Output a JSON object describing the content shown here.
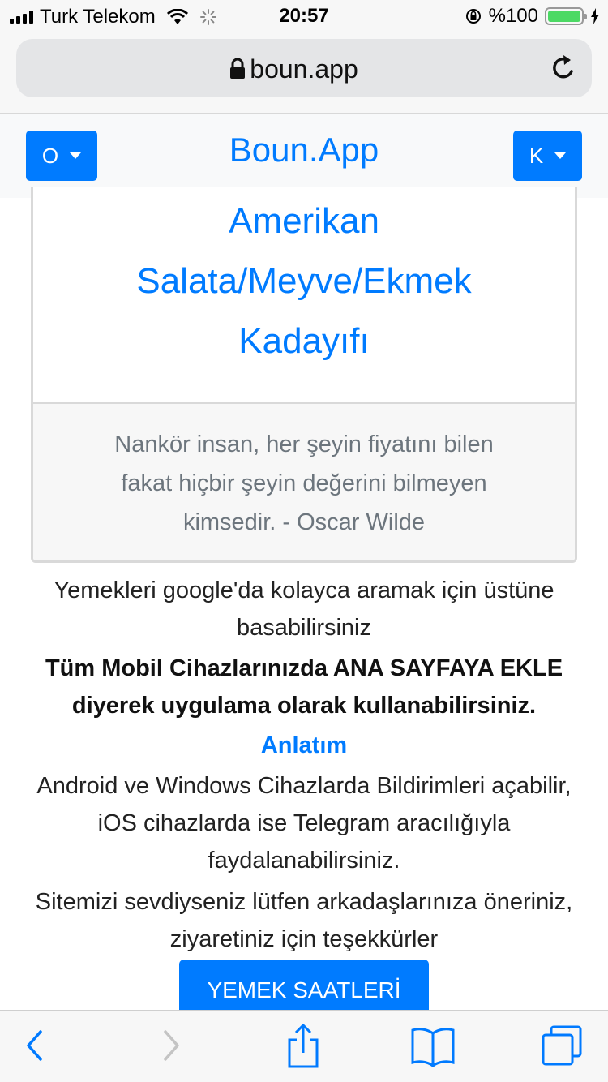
{
  "status_bar": {
    "carrier": "Turk Telekom",
    "time": "20:57",
    "battery_text": "%100",
    "battery_level": 1.0,
    "icons": [
      "signal-icon",
      "wifi-icon",
      "activity-spinner-icon",
      "orientation-lock-icon",
      "battery-icon",
      "charging-bolt-icon"
    ]
  },
  "browser": {
    "url": "boun.app",
    "icons": [
      "lock-icon",
      "reload-icon"
    ]
  },
  "header": {
    "brand": "Boun.App",
    "left_dropdown": "O",
    "right_dropdown": "K"
  },
  "card": {
    "dish_lines": [
      "Amerikan",
      "Salata/Meyve/Ekmek",
      "Kadayıfı"
    ],
    "quote_lines": [
      "Nankör insan, her şeyin fiyatını bilen",
      "fakat hiçbir şeyin değerini bilmeyen",
      "kimsedir. - Oscar Wilde"
    ]
  },
  "info": {
    "search_hint_lines": [
      "Yemekleri google'da kolayca aramak için üstüne",
      "basabilirsiniz"
    ],
    "bold_lines": [
      "Tüm Mobil Cihazlarınızda ANA SAYFAYA EKLE",
      "diyerek uygulama olarak kullanabilirsiniz."
    ],
    "link": "Anlatım",
    "notif_lines": [
      "Android ve Windows Cihazlarda Bildirimleri açabilir,",
      "iOS cihazlarda ise Telegram aracılığıyla",
      "faydalanabilirsiniz."
    ],
    "thanks_lines": [
      "Sitemizi sevdiyseniz lütfen arkadaşlarınıza öneriniz,",
      "ziyaretiniz için teşekkürler"
    ]
  },
  "button": {
    "label": "YEMEK SAATLERİ"
  },
  "toolbar": {
    "icons": [
      "back-icon",
      "forward-icon",
      "share-icon",
      "bookmarks-icon",
      "tabs-icon"
    ]
  },
  "colors": {
    "accent": "#007bff",
    "muted": "#6c757d",
    "battery": "#4cd964"
  }
}
